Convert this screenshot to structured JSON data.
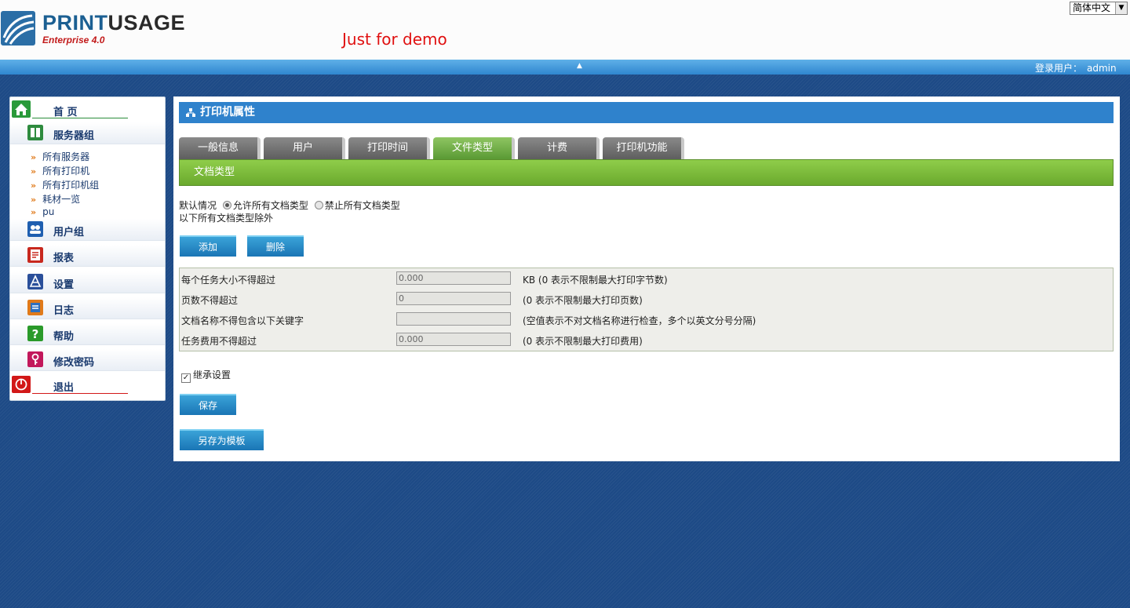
{
  "header": {
    "logo_main": "PRINT",
    "logo_main2": "USAGE",
    "logo_sub": "Enterprise 4.0",
    "demo_text": "Just for demo",
    "language": "简体中文"
  },
  "topbar": {
    "user_label": "登录用户：",
    "user_name": "admin"
  },
  "sidebar": {
    "home": "首 页",
    "server_group": "服务器组",
    "sub_items": [
      "所有服务器",
      "所有打印机",
      "所有打印机组",
      "耗材一览",
      "pu"
    ],
    "user_group": "用户组",
    "reports": "报表",
    "settings": "设置",
    "logs": "日志",
    "help": "帮助",
    "change_password": "修改密码",
    "logout": "退出"
  },
  "panel": {
    "title": "打印机属性",
    "tabs": [
      "一般信息",
      "用户",
      "打印时间",
      "文件类型",
      "计费",
      "打印机功能"
    ],
    "active_tab": "文件类型",
    "subtab": "文档类型",
    "default_label": "默认情况",
    "radio_allow": "允许所有文档类型",
    "radio_deny": "禁止所有文档类型",
    "except_text": "以下所有文档类型除外",
    "add_button": "添加",
    "delete_button": "删除",
    "limits": [
      {
        "label": "每个任务大小不得超过",
        "value": "0.000",
        "hint": "KB (0 表示不限制最大打印字节数)"
      },
      {
        "label": "页数不得超过",
        "value": "0",
        "hint": "(0 表示不限制最大打印页数)"
      },
      {
        "label": "文档名称不得包含以下关键字",
        "value": "",
        "hint": "(空值表示不对文档名称进行检查，多个以英文分号分隔)"
      },
      {
        "label": "任务费用不得超过",
        "value": "0.000",
        "hint": "(0 表示不限制最大打印费用)"
      }
    ],
    "inherit_label": "继承设置",
    "save_button": "保存",
    "save_template_button": "另存为模板"
  },
  "colors": {
    "title_bar": "#2f82cc",
    "active_tab": "#6aa92d",
    "tab": "#6e6e6e",
    "button": "#1a75b5"
  }
}
